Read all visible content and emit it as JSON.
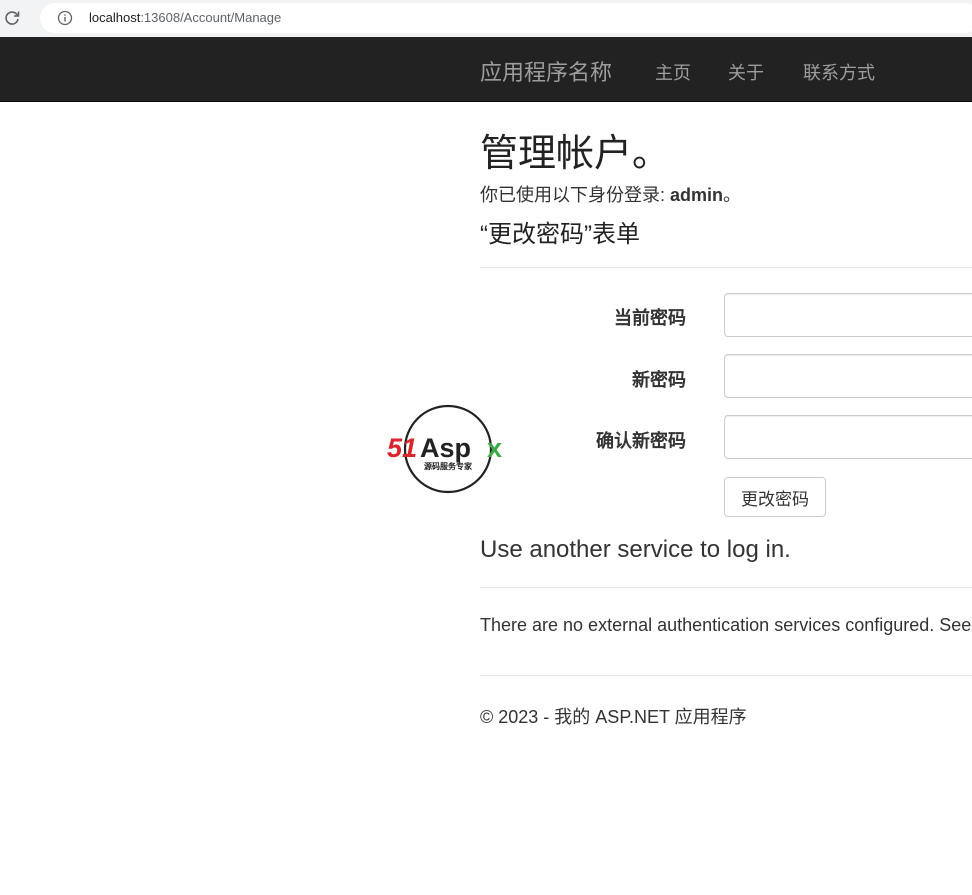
{
  "browser": {
    "url_host": "localhost",
    "url_path": ":13608/Account/Manage"
  },
  "navbar": {
    "brand": "应用程序名称",
    "links": [
      "主页",
      "关于",
      "联系方式"
    ]
  },
  "main": {
    "title": "管理帐户。",
    "login_prefix": "你已使用以下身份登录: ",
    "username": "admin",
    "login_suffix": "。",
    "form_title": "“更改密码”表单",
    "fields": [
      {
        "label": "当前密码",
        "value": ""
      },
      {
        "label": "新密码",
        "value": ""
      },
      {
        "label": "确认新密码",
        "value": ""
      }
    ],
    "submit_label": "更改密码",
    "external_title": "Use another service to log in.",
    "external_text": "There are no external authentication services configured. See"
  },
  "footer": {
    "text": "© 2023 - 我的 ASP.NET 应用程序"
  },
  "watermark": {
    "brand_text": "51Aspx",
    "tagline": "源码服务专家"
  },
  "colors": {
    "navbar_bg": "#222222",
    "navbar_text": "#9d9d9d",
    "logo_red": "#d9262c",
    "logo_green": "#3aa845"
  }
}
